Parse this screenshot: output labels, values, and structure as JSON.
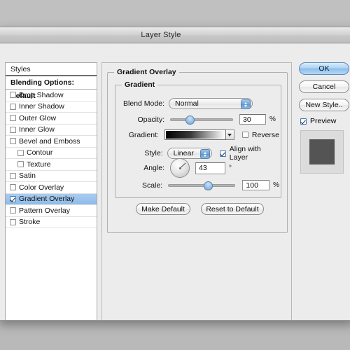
{
  "window": {
    "title": "Layer Style"
  },
  "sidebar": {
    "header": "Styles",
    "blending_options": "Blending Options: Default",
    "items": [
      {
        "label": "Drop Shadow",
        "checked": false,
        "indent": false,
        "selected": false
      },
      {
        "label": "Inner Shadow",
        "checked": false,
        "indent": false,
        "selected": false
      },
      {
        "label": "Outer Glow",
        "checked": false,
        "indent": false,
        "selected": false
      },
      {
        "label": "Inner Glow",
        "checked": false,
        "indent": false,
        "selected": false
      },
      {
        "label": "Bevel and Emboss",
        "checked": false,
        "indent": false,
        "selected": false
      },
      {
        "label": "Contour",
        "checked": false,
        "indent": true,
        "selected": false
      },
      {
        "label": "Texture",
        "checked": false,
        "indent": true,
        "selected": false
      },
      {
        "label": "Satin",
        "checked": false,
        "indent": false,
        "selected": false
      },
      {
        "label": "Color Overlay",
        "checked": false,
        "indent": false,
        "selected": false
      },
      {
        "label": "Gradient Overlay",
        "checked": true,
        "indent": false,
        "selected": true
      },
      {
        "label": "Pattern Overlay",
        "checked": false,
        "indent": false,
        "selected": false
      },
      {
        "label": "Stroke",
        "checked": false,
        "indent": false,
        "selected": false
      }
    ]
  },
  "main": {
    "section_title": "Gradient Overlay",
    "group_title": "Gradient",
    "blend_mode": {
      "label": "Blend Mode:",
      "value": "Normal"
    },
    "opacity": {
      "label": "Opacity:",
      "value": "30",
      "unit": "%",
      "slider_percent": 30
    },
    "gradient": {
      "label": "Gradient:",
      "start_color": "#000000",
      "end_color": "#ffffff",
      "reverse_label": "Reverse",
      "reverse_checked": false
    },
    "style": {
      "label": "Style:",
      "value": "Linear",
      "align_label": "Align with Layer",
      "align_checked": true
    },
    "angle": {
      "label": "Angle:",
      "value": "43",
      "unit": "°"
    },
    "scale": {
      "label": "Scale:",
      "value": "100",
      "unit": "%",
      "slider_percent": 58
    },
    "make_default": "Make Default",
    "reset_default": "Reset to Default"
  },
  "actions": {
    "ok": "OK",
    "cancel": "Cancel",
    "new_style": "New Style..",
    "preview_label": "Preview",
    "preview_checked": true
  },
  "colors": {
    "selection": "#8ebbe9",
    "accent": "#6ea4d6",
    "preview_square": "#545454"
  }
}
